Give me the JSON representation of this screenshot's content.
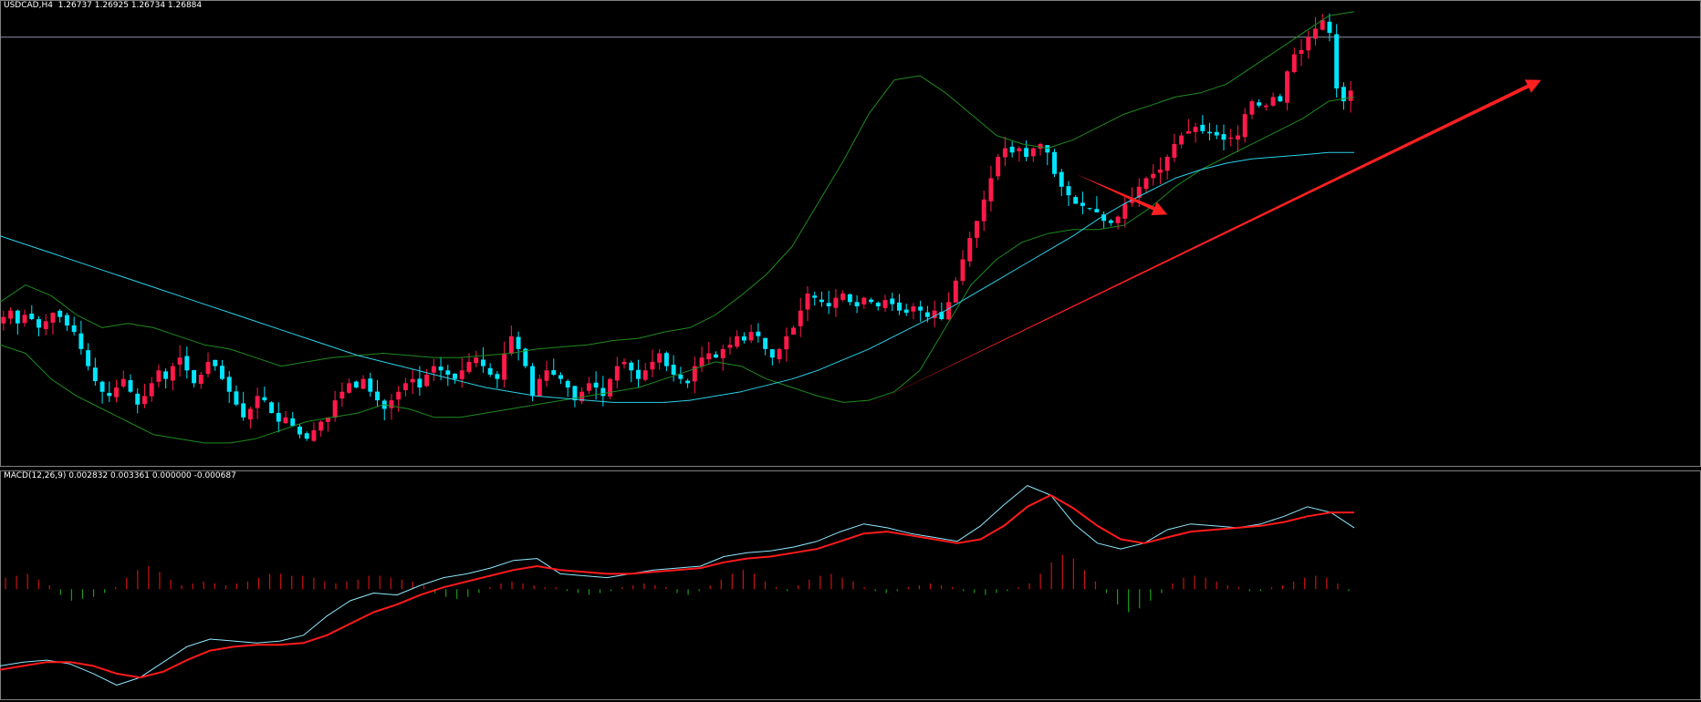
{
  "header": {
    "symbol_line": "USDCAD,H4  1.26737 1.26925 1.26734 1.26884",
    "macd_line": "MACD(12,26,9) 0.002832 0.003361 0.000000 -0.000687"
  },
  "colors": {
    "background": "#000000",
    "bull_candle": "#ff1a4a",
    "bear_candle": "#00e5ff",
    "moving_average": "#2ad0e8",
    "bollinger_bands": "#1f8a1f",
    "macd_line": "#8fe8ff",
    "signal_line": "#ff1a1a",
    "histogram_positive": "#cc1111",
    "histogram_negative": "#1a9a1a",
    "annotation_arrows": "#ff2020",
    "horizontal_line": "#8f8fa6",
    "grid": "#808080"
  },
  "chart_data": [
    {
      "type": "candlestick",
      "title": "USDCAD,H4",
      "ohlc_header": {
        "open": 1.26737,
        "high": 1.26925,
        "low": 1.26734,
        "close": 1.26884
      },
      "series": [
        {
          "kind": "candles",
          "close": [
            1.2595,
            1.2598,
            1.2592,
            1.2596,
            1.2594,
            1.259,
            1.2593,
            1.2597,
            1.2595,
            1.2591,
            1.2588,
            1.258,
            1.2572,
            1.2565,
            1.256,
            1.2558,
            1.2562,
            1.2566,
            1.256,
            1.2554,
            1.2558,
            1.2564,
            1.257,
            1.2566,
            1.2572,
            1.2576,
            1.257,
            1.2564,
            1.2568,
            1.2574,
            1.2572,
            1.2566,
            1.256,
            1.2554,
            1.2548,
            1.2552,
            1.2558,
            1.2556,
            1.255,
            1.2546,
            1.2548,
            1.2544,
            1.254,
            1.2538,
            1.2542,
            1.2546,
            1.2548,
            1.2556,
            1.256,
            1.2564,
            1.2562,
            1.2566,
            1.256,
            1.2556,
            1.2552,
            1.2556,
            1.256,
            1.2564,
            1.2566,
            1.2562,
            1.2568,
            1.2572,
            1.257,
            1.2568,
            1.2566,
            1.257,
            1.2574,
            1.2576,
            1.2572,
            1.2568,
            1.2566,
            1.2578,
            1.2586,
            1.258,
            1.2572,
            1.2558,
            1.2566,
            1.257,
            1.2568,
            1.2566,
            1.2562,
            1.2556,
            1.256,
            1.2564,
            1.2562,
            1.2558,
            1.2566,
            1.2572,
            1.2574,
            1.257,
            1.2566,
            1.257,
            1.2574,
            1.2578,
            1.2572,
            1.2568,
            1.2566,
            1.2564,
            1.2572,
            1.2576,
            1.2578,
            1.2576,
            1.258,
            1.2582,
            1.2586,
            1.2584,
            1.2588,
            1.2586,
            1.258,
            1.2576,
            1.258,
            1.2586,
            1.259,
            1.2598,
            1.2606,
            1.2604,
            1.2602,
            1.26,
            1.2604,
            1.2606,
            1.2602,
            1.26,
            1.2604,
            1.2602,
            1.26,
            1.2603,
            1.2601,
            1.2598,
            1.2597,
            1.26,
            1.2598,
            1.2595,
            1.2598,
            1.2594,
            1.2602,
            1.2612,
            1.2622,
            1.2632,
            1.264,
            1.265,
            1.266,
            1.267,
            1.2674,
            1.2672,
            1.2674,
            1.267,
            1.2674,
            1.2676,
            1.2672,
            1.2662,
            1.2656,
            1.2652,
            1.2648,
            1.2647,
            1.2646,
            1.2644,
            1.264,
            1.2639,
            1.2642,
            1.2648,
            1.265,
            1.2656,
            1.266,
            1.2662,
            1.2664,
            1.267,
            1.2676,
            1.268,
            1.2682,
            1.2684,
            1.2682,
            1.2681,
            1.268,
            1.2678,
            1.2679,
            1.268,
            1.269,
            1.2696,
            1.2694,
            1.2694,
            1.2698,
            1.2696,
            1.271,
            1.2718,
            1.272,
            1.2726,
            1.273,
            1.2734,
            1.2728,
            1.2702,
            1.2696,
            1.2701
          ]
        }
      ],
      "moving_average": [
        1.2633,
        1.2629,
        1.2625,
        1.2621,
        1.2617,
        1.2613,
        1.2609,
        1.2605,
        1.2601,
        1.2597,
        1.2593,
        1.2589,
        1.2585,
        1.2581,
        1.2577,
        1.2574,
        1.2571,
        1.2568,
        1.2565,
        1.2562,
        1.256,
        1.2558,
        1.2557,
        1.2556,
        1.2555,
        1.2555,
        1.2555,
        1.2556,
        1.2558,
        1.256,
        1.2563,
        1.2566,
        1.257,
        1.2575,
        1.258,
        1.2586,
        1.2592,
        1.2598,
        1.2605,
        1.2612,
        1.2619,
        1.2626,
        1.2633,
        1.2641,
        1.2648,
        1.2654,
        1.266,
        1.2664,
        1.2667,
        1.2669,
        1.267,
        1.2671,
        1.2672,
        1.2672
      ],
      "bollinger_upper": [
        1.2602,
        1.261,
        1.2605,
        1.2596,
        1.259,
        1.2592,
        1.259,
        1.2586,
        1.2582,
        1.258,
        1.2576,
        1.2572,
        1.2574,
        1.2576,
        1.2577,
        1.2578,
        1.2577,
        1.2576,
        1.2576,
        1.2577,
        1.2578,
        1.258,
        1.2581,
        1.2582,
        1.2584,
        1.2585,
        1.2588,
        1.259,
        1.2596,
        1.2605,
        1.2615,
        1.2628,
        1.2648,
        1.2668,
        1.269,
        1.2706,
        1.2708,
        1.27,
        1.269,
        1.268,
        1.2676,
        1.2674,
        1.2678,
        1.2684,
        1.269,
        1.2694,
        1.2698,
        1.27,
        1.2704,
        1.2712,
        1.272,
        1.2728,
        1.2736,
        1.2738
      ],
      "bollinger_lower": [
        1.2582,
        1.2578,
        1.2566,
        1.2558,
        1.2552,
        1.2546,
        1.254,
        1.2538,
        1.2536,
        1.2536,
        1.2538,
        1.2542,
        1.2546,
        1.2548,
        1.255,
        1.2554,
        1.2552,
        1.2548,
        1.2548,
        1.255,
        1.2552,
        1.2554,
        1.2556,
        1.2558,
        1.256,
        1.2562,
        1.2566,
        1.257,
        1.2574,
        1.2572,
        1.2566,
        1.2562,
        1.2558,
        1.2555,
        1.2556,
        1.256,
        1.257,
        1.259,
        1.261,
        1.2622,
        1.263,
        1.2634,
        1.2636,
        1.2636,
        1.2638,
        1.2646,
        1.2656,
        1.2664,
        1.267,
        1.2676,
        1.2682,
        1.2688,
        1.2696,
        1.2698
      ],
      "ylim": [
        1.253,
        1.274
      ],
      "price_lines": [
        1.2726
      ],
      "annotations": [
        {
          "kind": "arrow",
          "from": [
            152,
            1.2662
          ],
          "to": [
            165,
            1.2643
          ]
        },
        {
          "kind": "arrow",
          "from": [
            121,
            1.2551
          ],
          "to": [
            218,
            1.2706
          ]
        }
      ],
      "grid": false
    },
    {
      "type": "line",
      "title": "MACD(12,26,9)",
      "values_header": [
        0.002832,
        0.003361,
        0.0,
        -0.000687
      ],
      "series": [
        {
          "values": [
            -0.004,
            -0.0038,
            -0.0037,
            -0.0039,
            -0.0044,
            -0.005,
            -0.0046,
            -0.0038,
            -0.003,
            -0.0026,
            -0.0027,
            -0.0028,
            -0.0027,
            -0.0024,
            -0.0014,
            -0.0006,
            -0.0002,
            -0.0003,
            0.0002,
            0.0006,
            0.0008,
            0.0011,
            0.0015,
            0.0016,
            0.0008,
            0.0007,
            0.0006,
            0.0008,
            0.001,
            0.0011,
            0.0012,
            0.0017,
            0.0019,
            0.002,
            0.0022,
            0.0025,
            0.003,
            0.0034,
            0.0032,
            0.0029,
            0.0027,
            0.0025,
            0.0033,
            0.0044,
            0.0054,
            0.0049,
            0.0034,
            0.0024,
            0.0021,
            0.0024,
            0.0031,
            0.0034,
            0.0033,
            0.0032,
            0.0034,
            0.0038,
            0.0043,
            0.004,
            0.0032
          ]
        },
        {
          "values": [
            -0.0042,
            -0.004,
            -0.0038,
            -0.0038,
            -0.004,
            -0.0044,
            -0.0046,
            -0.0043,
            -0.0037,
            -0.0032,
            -0.003,
            -0.0029,
            -0.0029,
            -0.0028,
            -0.0024,
            -0.0018,
            -0.0012,
            -0.0008,
            -0.0003,
            0.0001,
            0.0004,
            0.0007,
            0.001,
            0.0012,
            0.001,
            0.0009,
            0.0008,
            0.0008,
            0.0009,
            0.001,
            0.0011,
            0.0014,
            0.0016,
            0.0017,
            0.0019,
            0.0021,
            0.0025,
            0.0029,
            0.003,
            0.0028,
            0.0026,
            0.0024,
            0.0026,
            0.0033,
            0.0043,
            0.0049,
            0.0042,
            0.0033,
            0.0026,
            0.0024,
            0.0027,
            0.003,
            0.0031,
            0.0032,
            0.0033,
            0.0035,
            0.0038,
            0.004,
            0.004
          ]
        }
      ],
      "histogram": [
        0.0006,
        0.0007,
        0.0008,
        0.0005,
        0.0002,
        -0.0003,
        -0.0006,
        -0.0005,
        -0.0004,
        -0.0002,
        0.0001,
        0.0006,
        0.001,
        0.0012,
        0.0009,
        0.0005,
        0.0002,
        0.0003,
        0.0004,
        0.0003,
        0.0002,
        0.0003,
        0.0004,
        0.0006,
        0.0008,
        0.0008,
        0.0007,
        0.0007,
        0.0006,
        0.0004,
        0.0003,
        0.0004,
        0.0005,
        0.0007,
        0.0007,
        0.0006,
        0.0005,
        0.0004,
        0.0002,
        -0.0002,
        -0.0004,
        -0.0005,
        -0.0004,
        -0.0002,
        0.0001,
        0.0003,
        0.0004,
        0.0003,
        0.0002,
        0.0001,
        0.0001,
        -0.0001,
        -0.0002,
        -0.0003,
        -0.0002,
        -0.0001,
        0.0001,
        0.0002,
        0.0003,
        0.0002,
        0.0001,
        -0.0002,
        -0.0003,
        -0.0001,
        0.0002,
        0.0005,
        0.0008,
        0.001,
        0.0008,
        0.0004,
        0.0001,
        -0.0001,
        0.0002,
        0.0005,
        0.0007,
        0.0008,
        0.0006,
        0.0004,
        0.0001,
        -0.0001,
        -0.0002,
        -0.0001,
        0.0001,
        0.0002,
        0.0003,
        0.0002,
        0.0001,
        -0.0001,
        -0.0002,
        -0.0003,
        -0.0002,
        -0.0001,
        0.0001,
        0.0003,
        0.0008,
        0.0014,
        0.0018,
        0.0016,
        0.001,
        0.0004,
        -0.0002,
        -0.0008,
        -0.0012,
        -0.001,
        -0.0006,
        -0.0002,
        0.0003,
        0.0006,
        0.0007,
        0.0006,
        0.0004,
        0.0002,
        0.0001,
        -0.0001,
        -0.0001,
        0.0001,
        0.0002,
        0.0004,
        0.0006,
        0.0007,
        0.0006,
        0.0003,
        -0.0001
      ],
      "ylim": [
        -0.0055,
        0.006
      ],
      "grid": false
    }
  ]
}
